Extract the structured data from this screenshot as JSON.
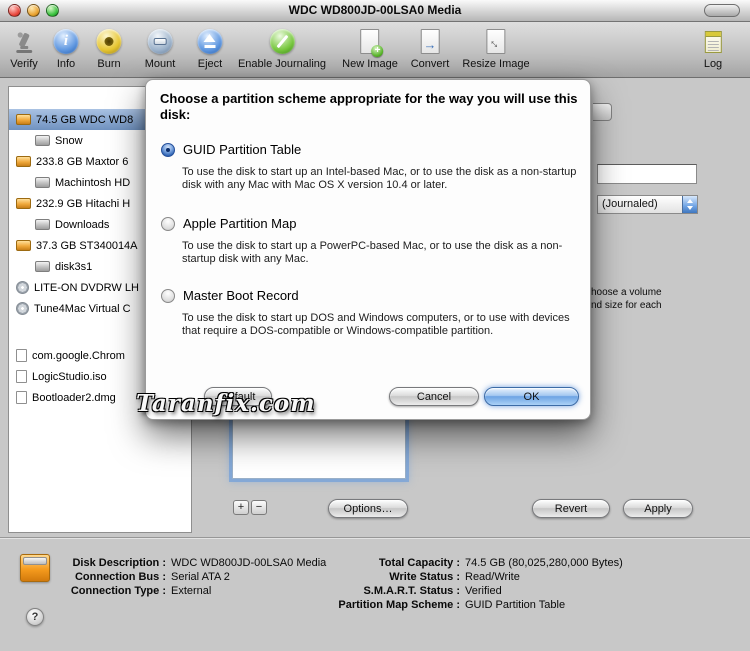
{
  "window": {
    "title": "WDC WD800JD-00LSA0 Media"
  },
  "colors": {
    "selection": "#7092c0",
    "ok_button": "#6da3e4",
    "focus_ring": "#7da5d7"
  },
  "toolbar": {
    "items": [
      {
        "label": "Verify"
      },
      {
        "label": "Info"
      },
      {
        "label": "Burn"
      },
      {
        "label": "Mount"
      },
      {
        "label": "Eject"
      },
      {
        "label": "Enable Journaling"
      },
      {
        "label": "New Image"
      },
      {
        "label": "Convert"
      },
      {
        "label": "Resize Image"
      },
      {
        "label": "Log"
      }
    ]
  },
  "sidebar": {
    "devices": [
      {
        "label": "74.5 GB WDC WD8",
        "selected": true
      },
      {
        "label": "Snow"
      },
      {
        "label": "233.8 GB Maxtor 6"
      },
      {
        "label": "Machintosh HD"
      },
      {
        "label": "232.9 GB Hitachi H"
      },
      {
        "label": "Downloads"
      },
      {
        "label": "37.3 GB ST340014A"
      },
      {
        "label": "disk3s1"
      },
      {
        "label": "LITE-ON DVDRW LH"
      },
      {
        "label": "Tune4Mac Virtual C"
      }
    ],
    "images": [
      {
        "label": "com.google.Chrom"
      },
      {
        "label": "LogicStudio.iso"
      },
      {
        "label": "Bootloader2.dmg"
      }
    ]
  },
  "dialog": {
    "prompt": "Choose a partition scheme appropriate for the way you will use this disk:",
    "options": [
      {
        "label": "GUID Partition Table",
        "selected": true,
        "description": "To use the disk to start up an Intel-based Mac, or to use the disk as a non-startup disk with any Mac with Mac OS X version 10.4 or later."
      },
      {
        "label": "Apple Partition Map",
        "selected": false,
        "description": "To use the disk to start up a PowerPC-based Mac, or to use the disk as a non-startup disk with any Mac."
      },
      {
        "label": "Master Boot Record",
        "selected": false,
        "description": "To use the disk to start up DOS and Windows computers, or to use with devices that require a DOS-compatible or Windows-compatible partition."
      }
    ],
    "buttons": {
      "default": "Default",
      "cancel": "Cancel",
      "ok": "OK"
    }
  },
  "background": {
    "format_fragment": "(Journaled)",
    "hint_line1": "hoose a volume",
    "hint_line2": "nd size for each",
    "add_button": "+",
    "remove_button": "−",
    "options_button": "Options…",
    "revert_button": "Revert",
    "apply_button": "Apply"
  },
  "info": {
    "rows_left": [
      {
        "label": "Disk Description :",
        "value": "WDC WD800JD-00LSA0 Media"
      },
      {
        "label": "Connection Bus :",
        "value": "Serial ATA 2"
      },
      {
        "label": "Connection Type :",
        "value": "External"
      }
    ],
    "rows_right": [
      {
        "label": "Total Capacity :",
        "value": "74.5 GB (80,025,280,000 Bytes)"
      },
      {
        "label": "Write Status :",
        "value": "Read/Write"
      },
      {
        "label": "S.M.A.R.T. Status :",
        "value": "Verified"
      },
      {
        "label": "Partition Map Scheme :",
        "value": "GUID Partition Table"
      }
    ],
    "help_label": "?"
  },
  "watermark": "Taranfix.com"
}
